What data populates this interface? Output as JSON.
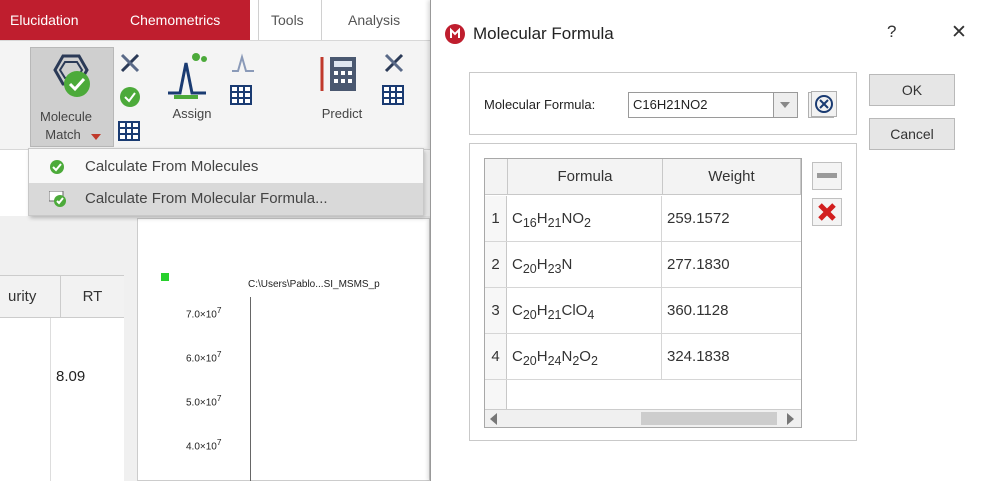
{
  "ribbon": {
    "tabs": [
      "Elucidation",
      "Chemometrics",
      "Tools",
      "Analysis"
    ],
    "molecule_match": "Molecule",
    "molecule_match_2": "Match",
    "assign": "Assign",
    "predict": "Predict"
  },
  "menu": {
    "items": [
      {
        "label": "Calculate From Molecules"
      },
      {
        "label": "Calculate From Molecular Formula..."
      }
    ]
  },
  "background_table": {
    "headers": [
      "urity",
      "RT"
    ],
    "rt_value": "8.09"
  },
  "chart": {
    "title": "C:\\Users\\Pablo...SI_MSMS_p",
    "yticks": [
      {
        "mant": "7.0",
        "exp": "7"
      },
      {
        "mant": "6.0",
        "exp": "7"
      },
      {
        "mant": "5.0",
        "exp": "7"
      },
      {
        "mant": "4.0",
        "exp": "7"
      }
    ],
    "times_sign": "×10"
  },
  "dialog": {
    "title": "Molecular Formula",
    "help": "?",
    "close": "✕",
    "ok": "OK",
    "cancel": "Cancel",
    "mf_label": "Molecular Formula:",
    "mf_value": "C16H21NO2",
    "table": {
      "headers": [
        "Formula",
        "Weight"
      ],
      "rows": [
        {
          "n": "1",
          "weight": "259.1572"
        },
        {
          "n": "2",
          "weight": "277.1830"
        },
        {
          "n": "3",
          "weight": "360.1128"
        },
        {
          "n": "4",
          "weight": "324.1838"
        }
      ]
    }
  },
  "colors": {
    "accent_red": "#bf1e2e",
    "blue_plus": "#1e6fd6",
    "delete_red": "#d21f1f"
  }
}
